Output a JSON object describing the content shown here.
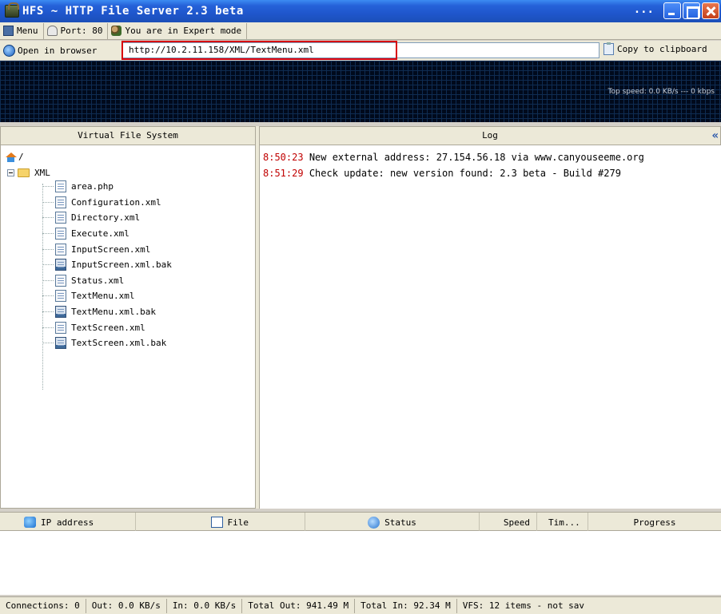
{
  "window": {
    "title": "HFS ~ HTTP File Server 2.3 beta",
    "title_dots": "..."
  },
  "toolbar": {
    "menu_label": "Menu",
    "port_label": "Port: 80",
    "mode_label": "You are in Expert mode"
  },
  "address_bar": {
    "open_label": "Open in browser",
    "url": "http://10.2.11.158/XML/TextMenu.xml",
    "copy_label": "Copy to clipboard"
  },
  "graph": {
    "speed_text": "Top speed: 0.0 KB/s  ---  0 kbps"
  },
  "vfs": {
    "header": "Virtual File System",
    "root": "/",
    "folder": "XML",
    "files": [
      {
        "name": "area.php",
        "icon": "php-file-icon"
      },
      {
        "name": "Configuration.xml",
        "icon": "xml-file-icon"
      },
      {
        "name": "Directory.xml",
        "icon": "xml-file-icon"
      },
      {
        "name": "Execute.xml",
        "icon": "xml-file-icon"
      },
      {
        "name": "InputScreen.xml",
        "icon": "xml-file-icon"
      },
      {
        "name": "InputScreen.xml.bak",
        "icon": "bak-file-icon"
      },
      {
        "name": "Status.xml",
        "icon": "xml-file-icon"
      },
      {
        "name": "TextMenu.xml",
        "icon": "xml-file-icon"
      },
      {
        "name": "TextMenu.xml.bak",
        "icon": "bak-file-icon"
      },
      {
        "name": "TextScreen.xml",
        "icon": "xml-file-icon"
      },
      {
        "name": "TextScreen.xml.bak",
        "icon": "bak-file-icon"
      }
    ]
  },
  "log": {
    "header": "Log",
    "collapse": "«",
    "lines": [
      {
        "time": "8:50:23",
        "text": "New external address: 27.154.56.18 via www.canyouseeme.org"
      },
      {
        "time": "8:51:29",
        "text": "Check update: new version found: 2.3 beta - Build #279"
      }
    ]
  },
  "connections": {
    "columns": {
      "ip": "IP address",
      "file": "File",
      "status": "Status",
      "speed": "Speed",
      "time": "Tim...",
      "progress": "Progress"
    }
  },
  "statusbar": {
    "connections": "Connections: 0",
    "out": "Out: 0.0 KB/s",
    "in": "In: 0.0 KB/s",
    "total_out": "Total Out: 941.49 M",
    "total_in": "Total In: 92.34 M",
    "vfs": "VFS: 12 items - not sav"
  },
  "colors": {
    "title_bar": "#2562d9",
    "log_time": "#c00000",
    "url_highlight": "#d8000c",
    "graph_bg": "#000a1c"
  }
}
